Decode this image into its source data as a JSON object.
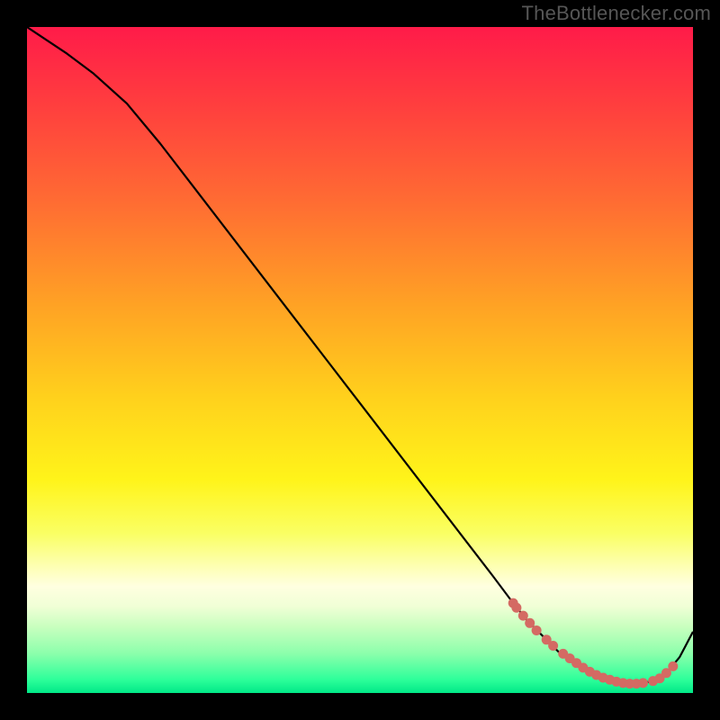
{
  "attribution": "TheBottlenecker.com",
  "colors": {
    "curve": "#000000",
    "marker": "#d46a63",
    "gradient_top": "#ff1b49",
    "gradient_mid": "#fff41a",
    "gradient_bottom": "#00e887"
  },
  "chart_data": {
    "type": "line",
    "title": "",
    "xlabel": "",
    "ylabel": "",
    "xlim": [
      0,
      100
    ],
    "ylim": [
      0,
      100
    ],
    "x": [
      0,
      3,
      6,
      10,
      15,
      20,
      25,
      30,
      35,
      40,
      45,
      50,
      55,
      60,
      65,
      70,
      73,
      75,
      78,
      80,
      82,
      84,
      86,
      88,
      90,
      92,
      94,
      96,
      98,
      100
    ],
    "y": [
      100,
      98,
      96,
      93,
      88.5,
      82.5,
      76,
      69.5,
      63,
      56.5,
      50,
      43.5,
      37,
      30.5,
      24,
      17.5,
      13.5,
      11,
      8,
      6,
      4.5,
      3.2,
      2.3,
      1.7,
      1.4,
      1.4,
      1.8,
      3.0,
      5.4,
      9.2
    ],
    "markers_x": [
      73,
      73.5,
      74.5,
      75.5,
      76.5,
      78,
      79,
      80.5,
      81.5,
      82.5,
      83.5,
      84.5,
      85.5,
      86.5,
      87.5,
      88.5,
      89.5,
      90.5,
      91.5,
      92.5,
      94,
      95,
      96,
      97
    ],
    "markers_y": [
      13.5,
      12.8,
      11.6,
      10.5,
      9.4,
      8.0,
      7.1,
      5.9,
      5.2,
      4.5,
      3.8,
      3.2,
      2.7,
      2.3,
      2.0,
      1.7,
      1.5,
      1.4,
      1.4,
      1.5,
      1.8,
      2.2,
      3.0,
      4.0
    ]
  }
}
